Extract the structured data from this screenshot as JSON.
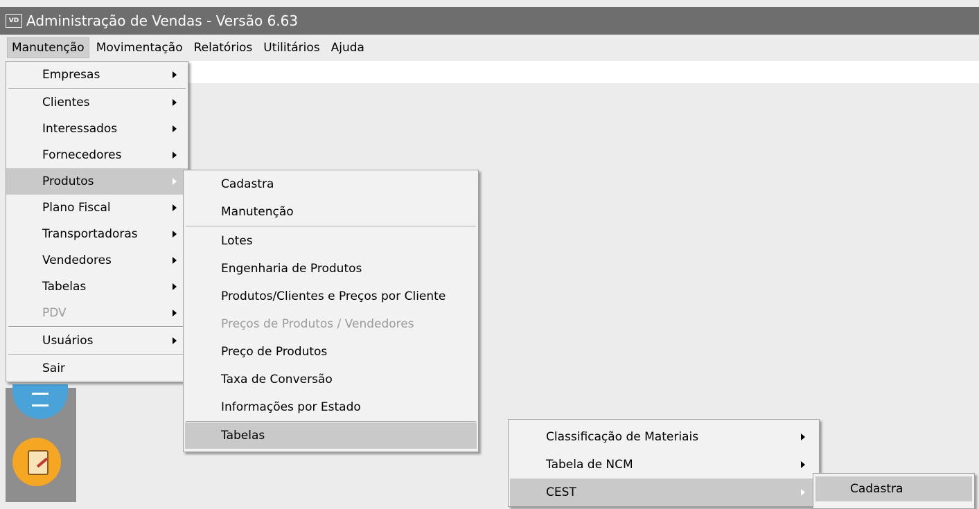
{
  "window": {
    "title": "Administração de Vendas - Versão 6.63",
    "icon_text": "VD"
  },
  "menubar": {
    "items": [
      "Manutenção",
      "Movimentação",
      "Relatórios",
      "Utilitários",
      "Ajuda"
    ]
  },
  "menu_manutencao": {
    "items": [
      "Empresas",
      "Clientes",
      "Interessados",
      "Fornecedores",
      "Produtos",
      "Plano Fiscal",
      "Transportadoras",
      "Vendedores",
      "Tabelas",
      "PDV",
      "Usuários",
      "Sair"
    ]
  },
  "menu_produtos": {
    "items": [
      "Cadastra",
      "Manutenção",
      "Lotes",
      "Engenharia de Produtos",
      "Produtos/Clientes e Preços por Cliente",
      "Preços de Produtos / Vendedores",
      "Preço de Produtos",
      "Taxa de Conversão",
      "Informações por Estado",
      "Tabelas"
    ]
  },
  "menu_tabelas": {
    "items": [
      "Classificação de Materiais",
      "Tabela de NCM",
      "CEST"
    ]
  },
  "menu_cest": {
    "items": [
      "Cadastra"
    ]
  },
  "colors": {
    "titlebar": "#6e6e6e",
    "highlight": "#c9c9c9",
    "disabled": "#9b9b9b",
    "menu_bg": "#f2f2f2"
  }
}
